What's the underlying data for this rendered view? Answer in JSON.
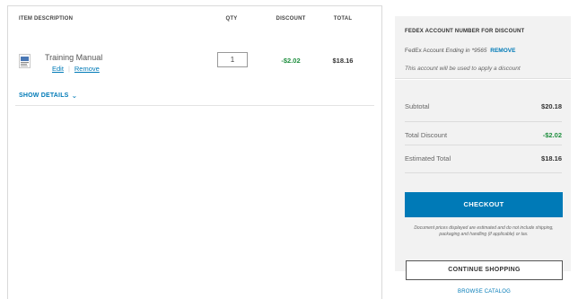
{
  "cart": {
    "headers": {
      "description": "ITEM DESCRIPTION",
      "qty": "QTY",
      "discount": "DISCOUNT",
      "total": "TOTAL"
    },
    "items": [
      {
        "name": "Training Manual",
        "edit_label": "Edit",
        "remove_label": "Remove",
        "qty": "1",
        "discount": "-$2.02",
        "total": "$18.16",
        "icon": "document-thumbnail-icon"
      }
    ],
    "show_details_label": "SHOW DETAILS"
  },
  "fedex_account": {
    "title": "FEDEX ACCOUNT NUMBER FOR DISCOUNT",
    "account_prefix": "FedEx Account",
    "account_ending": "Ending in *9565",
    "remove_label": "REMOVE",
    "note": "This account will be used to apply a discount"
  },
  "summary": {
    "subtotal_label": "Subtotal",
    "subtotal_value": "$20.18",
    "discount_label": "Total Discount",
    "discount_value": "-$2.02",
    "estimated_label": "Estimated Total",
    "estimated_value": "$18.16",
    "checkout_label": "CHECKOUT",
    "disclaimer": "Document prices displayed are estimated and do not include shipping, packaging and handling (if applicable) or tax."
  },
  "actions": {
    "continue_label": "CONTINUE SHOPPING",
    "browse_label": "BROWSE CATALOG"
  },
  "colors": {
    "accent": "#007ab7",
    "discount": "#1e8e3e",
    "panel_bg": "#f2f2f2"
  }
}
